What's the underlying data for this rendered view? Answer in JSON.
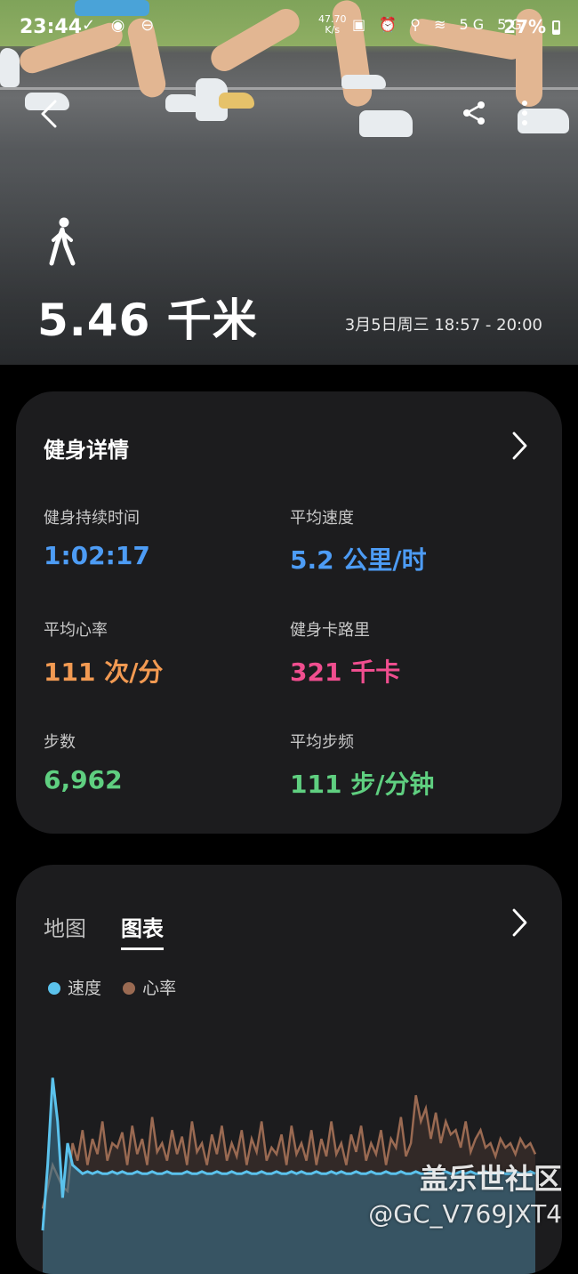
{
  "status_bar": {
    "time": "23:44",
    "net_speed": "47.70",
    "net_unit": "K/s",
    "battery": "27%",
    "left_icons": "✓ ◉ ⊖",
    "right_icons": "▣ ⏰ ⚲ ≋ 5G 5G"
  },
  "hero": {
    "activity_icon": "walking-person-icon",
    "distance": "5.46 千米",
    "date_range": "3月5日周三 18:57 - 20:00"
  },
  "details": {
    "title": "健身详情",
    "stats": [
      {
        "label": "健身持续时间",
        "value": "1:02:17",
        "color": "#4d9cf5"
      },
      {
        "label": "平均速度",
        "value": "5.2 公里/时",
        "color": "#4d9cf5"
      },
      {
        "label": "平均心率",
        "value": "111 次/分",
        "color": "#f29a52"
      },
      {
        "label": "健身卡路里",
        "value": "321 千卡",
        "color": "#f04e8f"
      },
      {
        "label": "步数",
        "value": "6,962",
        "color": "#5fcf80"
      },
      {
        "label": "平均步频",
        "value": "111 步/分钟",
        "color": "#5fcf80"
      }
    ]
  },
  "chart_card": {
    "tabs": [
      "地图",
      "图表"
    ],
    "active_tab": "图表",
    "legend": [
      {
        "name": "速度",
        "color": "#5bc2ec"
      },
      {
        "name": "心率",
        "color": "#9a6a52"
      }
    ]
  },
  "chart_data": {
    "type": "line",
    "title": "",
    "xlabel": "",
    "ylabel": "",
    "series": [
      {
        "name": "速度",
        "color": "#5bc2ec",
        "values": [
          0.2,
          0.5,
          0.9,
          0.7,
          0.35,
          0.6,
          0.5,
          0.48,
          0.46,
          0.47,
          0.46,
          0.47,
          0.46,
          0.46,
          0.47,
          0.46,
          0.47,
          0.46,
          0.46,
          0.47,
          0.46,
          0.46,
          0.47,
          0.46,
          0.46,
          0.47,
          0.46,
          0.46,
          0.46,
          0.47,
          0.46,
          0.46,
          0.47,
          0.46,
          0.46,
          0.47,
          0.46,
          0.46,
          0.47,
          0.46,
          0.46,
          0.47,
          0.46,
          0.46,
          0.47,
          0.46,
          0.46,
          0.47,
          0.46,
          0.46,
          0.47,
          0.46,
          0.47,
          0.46,
          0.46,
          0.47,
          0.46,
          0.46,
          0.47,
          0.46,
          0.47,
          0.46,
          0.46,
          0.47,
          0.46,
          0.46,
          0.47,
          0.46,
          0.46,
          0.47,
          0.46,
          0.46,
          0.47,
          0.46,
          0.46,
          0.47,
          0.46,
          0.46,
          0.47,
          0.46,
          0.46,
          0.47,
          0.46,
          0.46,
          0.47,
          0.46,
          0.47,
          0.46,
          0.46,
          0.47,
          0.46,
          0.46,
          0.47,
          0.46,
          0.46,
          0.47,
          0.46,
          0.46,
          0.47,
          0.46
        ]
      },
      {
        "name": "心率",
        "color": "#9a6a52",
        "values": [
          0.3,
          0.4,
          0.5,
          0.45,
          0.4,
          0.38,
          0.6,
          0.52,
          0.66,
          0.5,
          0.62,
          0.55,
          0.7,
          0.52,
          0.6,
          0.58,
          0.65,
          0.5,
          0.68,
          0.55,
          0.62,
          0.5,
          0.72,
          0.56,
          0.6,
          0.52,
          0.66,
          0.55,
          0.63,
          0.5,
          0.7,
          0.56,
          0.6,
          0.5,
          0.64,
          0.55,
          0.68,
          0.52,
          0.6,
          0.54,
          0.66,
          0.5,
          0.62,
          0.56,
          0.7,
          0.52,
          0.58,
          0.55,
          0.64,
          0.5,
          0.68,
          0.55,
          0.6,
          0.52,
          0.66,
          0.5,
          0.62,
          0.54,
          0.7,
          0.55,
          0.6,
          0.5,
          0.64,
          0.56,
          0.68,
          0.52,
          0.6,
          0.55,
          0.66,
          0.5,
          0.62,
          0.58,
          0.72,
          0.54,
          0.6,
          0.82,
          0.7,
          0.76,
          0.62,
          0.74,
          0.6,
          0.7,
          0.64,
          0.66,
          0.58,
          0.7,
          0.56,
          0.62,
          0.66,
          0.58,
          0.6,
          0.54,
          0.62,
          0.58,
          0.6,
          0.55,
          0.62,
          0.58,
          0.6,
          0.55
        ]
      }
    ]
  },
  "watermark": {
    "line1": "盖乐世社区",
    "line2": "@GC_V769JXT4"
  }
}
